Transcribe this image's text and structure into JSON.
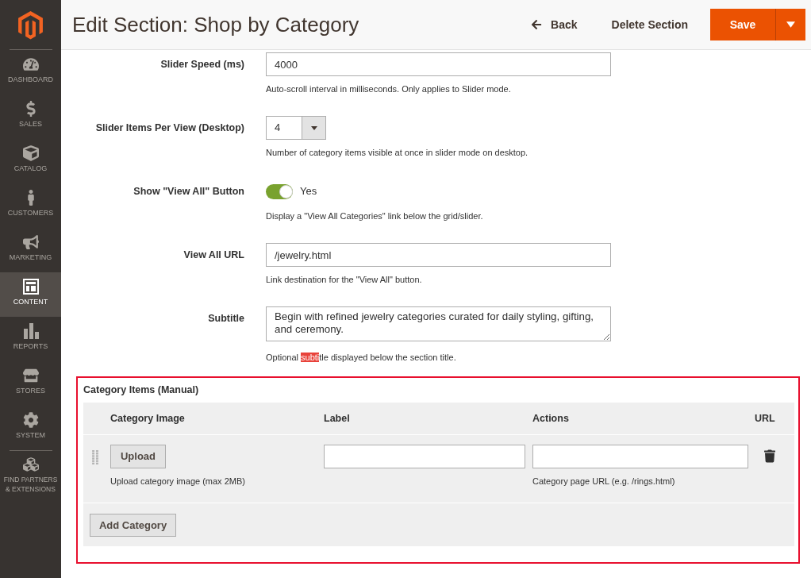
{
  "sidebar": {
    "items": [
      {
        "label": "DASHBOARD",
        "selected": false
      },
      {
        "label": "SALES",
        "selected": false
      },
      {
        "label": "CATALOG",
        "selected": false
      },
      {
        "label": "CUSTOMERS",
        "selected": false
      },
      {
        "label": "MARKETING",
        "selected": false
      },
      {
        "label": "CONTENT",
        "selected": true
      },
      {
        "label": "REPORTS",
        "selected": false
      },
      {
        "label": "STORES",
        "selected": false
      },
      {
        "label": "SYSTEM",
        "selected": false
      }
    ],
    "footer_item": {
      "label": "FIND PARTNERS & EXTENSIONS",
      "selected": false
    }
  },
  "header": {
    "title": "Edit Section: Shop by Category",
    "back": "Back",
    "delete": "Delete Section",
    "save": "Save"
  },
  "fields": [
    {
      "kind": "text",
      "label": "Slider Speed (ms)",
      "value": "4000",
      "note": [
        {
          "text": "Auto-scroll interval in milliseconds. Only applies to Slider mode.",
          "highlighted": false
        }
      ]
    },
    {
      "kind": "select",
      "label": "Slider Items Per View (Desktop)",
      "value": "4",
      "note": [
        {
          "text": "Number of category items visible at once in slider mode on desktop.",
          "highlighted": false
        }
      ]
    },
    {
      "kind": "toggle",
      "label": "Show \"View All\" Button",
      "on": true,
      "state_label": "Yes",
      "note": [
        {
          "text": "Display a \"View All Categories\" link below the grid/slider.",
          "highlighted": false
        }
      ]
    },
    {
      "kind": "text",
      "label": "View All URL",
      "value": "/jewelry.html",
      "note": [
        {
          "text": "Link destination for the \"View All\" button.",
          "highlighted": false
        }
      ]
    },
    {
      "kind": "textarea",
      "label": "Subtitle",
      "value": "Begin with refined jewelry categories curated for daily styling, gifting, and ceremony.",
      "note": [
        {
          "text": "Optional ",
          "highlighted": false
        },
        {
          "text": "subti",
          "highlighted": true
        },
        {
          "text": "tle displayed below the section title.",
          "highlighted": false
        }
      ]
    }
  ],
  "category_items": {
    "title": "Category Items (Manual)",
    "framed": true,
    "columns": [
      "Category Image",
      "Label",
      "Actions",
      "URL"
    ],
    "rows": [
      {
        "upload_button": "Upload",
        "upload_note": "Upload category image (max 2MB)",
        "url_note": "Category page URL (e.g. /rings.html)"
      }
    ],
    "add_button": "Add Category"
  }
}
